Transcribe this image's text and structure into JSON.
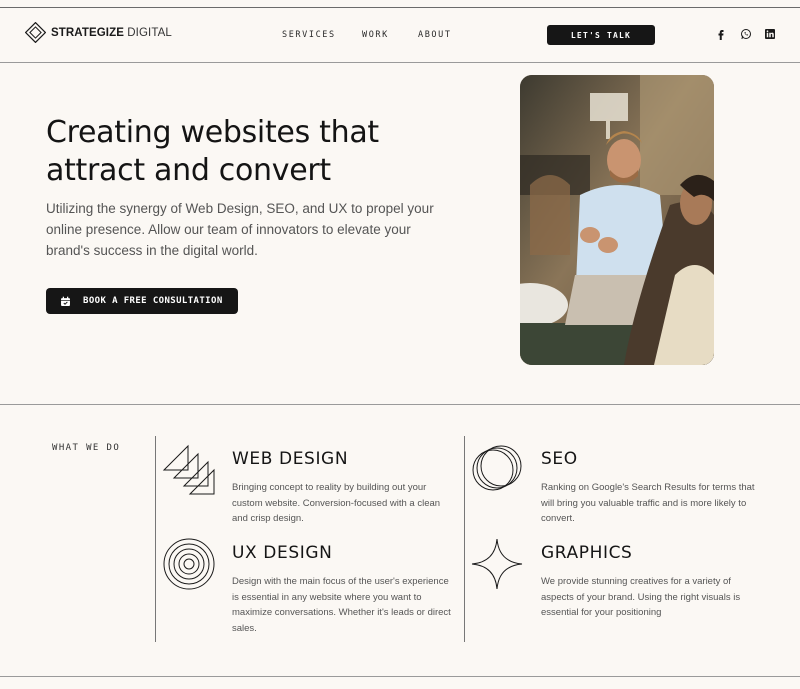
{
  "brand": {
    "name_bold": "STRATEGIZE",
    "name_light": "DIGITAL"
  },
  "nav": {
    "services": "SERVICES",
    "work": "WORK",
    "about": "ABOUT"
  },
  "header_cta": "LET'S TALK",
  "social": [
    "facebook-icon",
    "whatsapp-icon",
    "linkedin-icon"
  ],
  "hero": {
    "title": "Creating websites that attract and convert",
    "subtitle": "Utilizing the synergy of Web Design, SEO, and UX to propel your online presence. Allow our team of innovators to elevate your brand's success in the digital world.",
    "button_label": "BOOK A FREE CONSULTATION"
  },
  "services_section": {
    "label": "WHAT WE DO",
    "items": [
      {
        "title": "WEB DESIGN",
        "description": "Bringing concept to reality by building out your custom website. Conversion-focused with a clean and crisp design.",
        "icon": "stacked-triangles-icon"
      },
      {
        "title": "SEO",
        "description": "Ranking on Google's Search Results for terms that will bring you valuable traffic and is more likely to convert.",
        "icon": "overlapping-circles-icon"
      },
      {
        "title": "UX DESIGN",
        "description": "Design with the main focus of the user's experience is essential in any website where you want to maximize conversations.  Whether it's leads or direct sales.",
        "icon": "concentric-circles-icon"
      },
      {
        "title": "GRAPHICS",
        "description": "We provide stunning creatives for a variety of aspects of your brand. Using the right visuals is essential for your positioning",
        "icon": "four-point-star-icon"
      }
    ]
  },
  "colors": {
    "background": "#fbf8f4",
    "dark": "#161616",
    "text_muted": "#555555"
  }
}
